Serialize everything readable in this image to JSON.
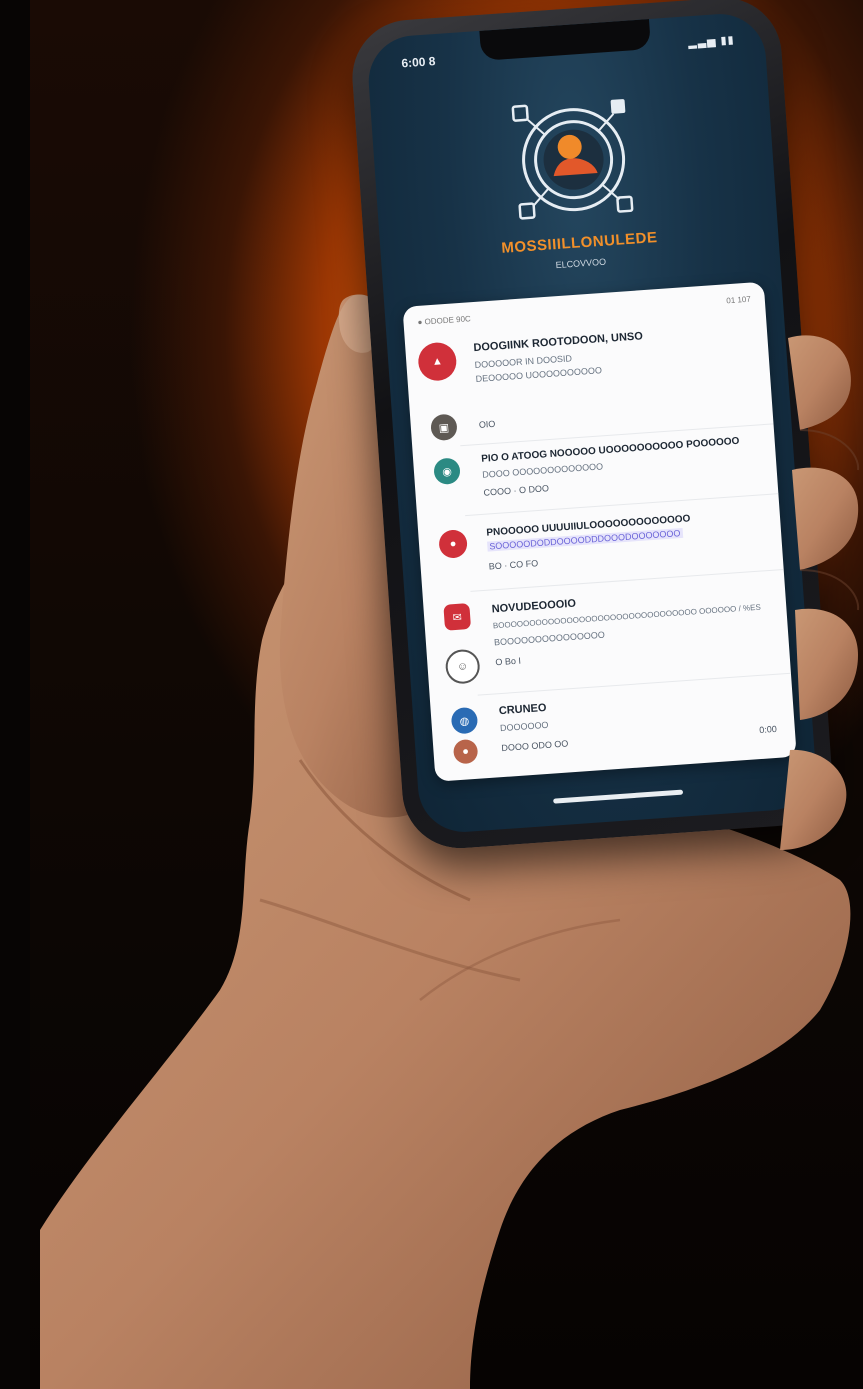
{
  "colors": {
    "glow": "#ff7a12",
    "accent": "#f2902a",
    "card_bg": "#fbfbfc",
    "red": "#d0303a",
    "teal": "#2b8a83",
    "blue": "#2a6bb4"
  },
  "status_bar": {
    "time": "6:00 8",
    "icons": "▂▃▅ ▮▮"
  },
  "app": {
    "title": "MOSSIIILLONULEDE",
    "subtitle": "ELCOVVOO",
    "logo": "brand-logo-icon"
  },
  "card": {
    "header_left": "● ODODE 90C",
    "header_right": "01 107",
    "items": [
      {
        "icon": "alert-icon",
        "title": "DOOGIINK ROOTODOON, UNSO",
        "line1": "DOOOOOR IN DOOSID",
        "line2": "DEOOOOO UOOOOOOOOOO"
      },
      {
        "icon": "device-icon",
        "title": "",
        "line1": "OIO",
        "line2": ""
      },
      {
        "icon": "app-icon",
        "title": "PIO O ATOOG NOOOOO UOOOOOOOOOO POOOOOO",
        "line1": "DOOO OOOOOOOOOOOOO",
        "line2": "COOO · O DOO"
      },
      {
        "icon": "notification-icon",
        "title": "PNOOOOO UUUUIIULOOOOOOOOOOOOO",
        "line1": "SOOOOODODDOOOODDDOOODOOOOOOO",
        "line2": "BO · CO FO"
      },
      {
        "icon": "message-icon",
        "title": "NOVUDEOOOIO",
        "line1": "BOOOOOOOOOOOOOOOOOOOOOOOOOOOOOOOO OOOOOO / %ES",
        "line2": "BOOOOOOOOOOOOOOO",
        "line3": "O   Bo  I"
      },
      {
        "icon": "globe-icon",
        "title": "CRUNEO",
        "line1": "DOOOOOO",
        "line2": "DOOO ODO     OO",
        "time": "0:00"
      }
    ]
  }
}
